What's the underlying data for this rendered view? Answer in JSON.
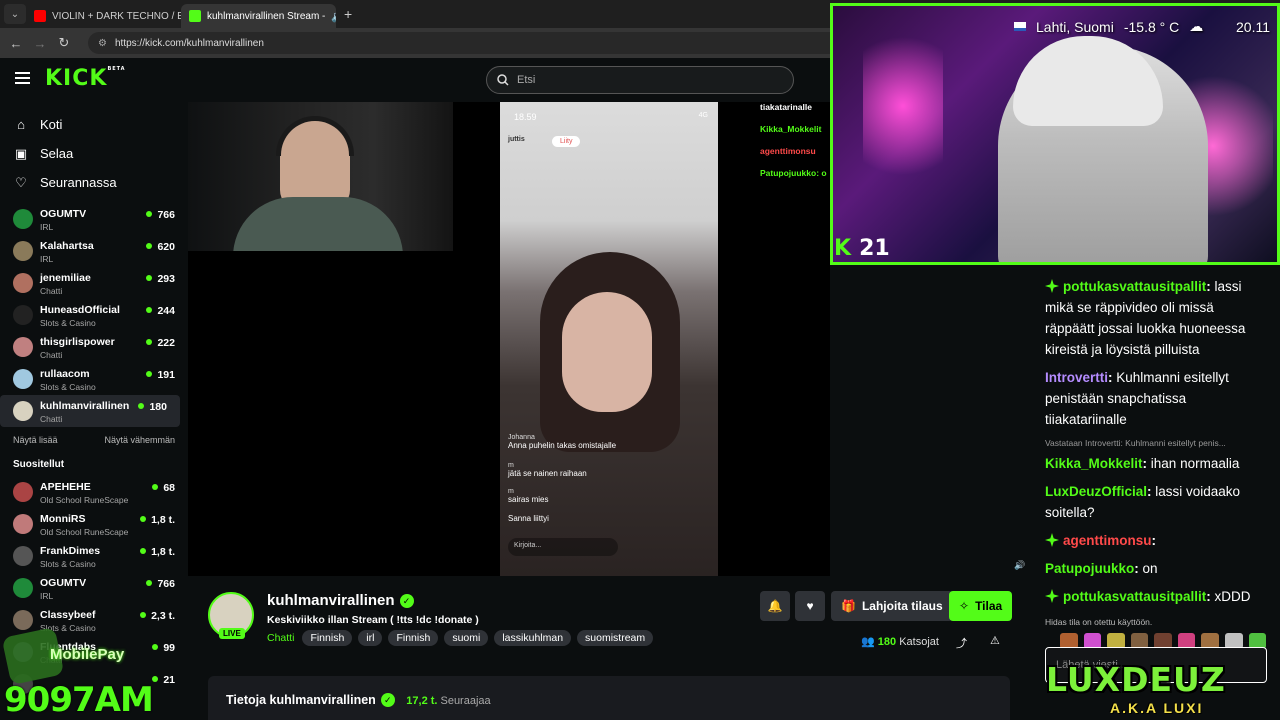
{
  "browser": {
    "tabs": [
      {
        "title": "VIOLIN + DARK TECHNO / EBM",
        "color": "#ff0000"
      },
      {
        "title": "kuhlmanvirallinen Stream -",
        "color": "#53fc18"
      }
    ],
    "url": "https://kick.com/kuhlmanvirallinen"
  },
  "header": {
    "logo": "KICK",
    "logo_sup": "BETA",
    "search_placeholder": "Etsi"
  },
  "sidebar": {
    "nav": [
      {
        "label": "Koti",
        "icon": "home-icon"
      },
      {
        "label": "Selaa",
        "icon": "browse-icon"
      },
      {
        "label": "Seurannassa",
        "icon": "heart-icon"
      }
    ],
    "following": [
      {
        "name": "OGUMTV",
        "category": "IRL",
        "viewers": "766",
        "color": "#1f8a3a"
      },
      {
        "name": "Kalahartsa",
        "category": "IRL",
        "viewers": "620",
        "color": "#8a7a5a"
      },
      {
        "name": "jenemiliae",
        "category": "Chatti",
        "viewers": "293",
        "color": "#b07060"
      },
      {
        "name": "HuneasdOfficial",
        "category": "Slots & Casino",
        "viewers": "244",
        "color": "#222"
      },
      {
        "name": "thisgirlispower",
        "category": "Chatti",
        "viewers": "222",
        "color": "#c08080"
      },
      {
        "name": "rullaacom",
        "category": "Slots & Casino",
        "viewers": "191",
        "color": "#a0c8e0"
      },
      {
        "name": "kuhlmanvirallinen",
        "category": "Chatti",
        "viewers": "180",
        "color": "#d8d2c0"
      }
    ],
    "show_more": "Näytä lisää",
    "show_less": "Näytä vähemmän",
    "recommended_title": "Suositellut",
    "recommended": [
      {
        "name": "APEHEHE",
        "category": "Old School RuneScape",
        "viewers": "68",
        "color": "#aa4444"
      },
      {
        "name": "MonniRS",
        "category": "Old School RuneScape",
        "viewers": "1,8 t.",
        "color": "#c07a7a"
      },
      {
        "name": "FrankDimes",
        "category": "Slots & Casino",
        "viewers": "1,8 t.",
        "color": "#555"
      },
      {
        "name": "OGUMTV",
        "category": "IRL",
        "viewers": "766",
        "color": "#1f8a3a"
      },
      {
        "name": "Classybeef",
        "category": "Slots & Casino",
        "viewers": "2,3 t.",
        "color": "#7a6a5a"
      },
      {
        "name": "Fluentdabs",
        "category": "Chatti",
        "viewers": "99",
        "color": "#6a6a8a"
      },
      {
        "name": "",
        "category": "",
        "viewers": "21",
        "color": "#444"
      }
    ]
  },
  "video": {
    "phone_time": "18.59",
    "phone_net": "4G",
    "phone_user": "juttis",
    "phone_join": "Liity",
    "phone_comments": [
      {
        "user": "Johanna",
        "text": "Anna puhelin takas omistajalle"
      },
      {
        "user": "m",
        "text": "jätä se nainen raihaan"
      },
      {
        "user": "m",
        "text": "sairas mies"
      },
      {
        "user": "Sanna",
        "text": "liittyi"
      }
    ],
    "phone_ask": "Kirjoita...",
    "overlay_chat": [
      "tiakatarinalle",
      "Kikka_Mokkelit",
      "agenttimonsu",
      "Patupojuukko: o"
    ]
  },
  "facecam": {
    "location": "Lahti, Suomi",
    "temp": "-15.8 ° C",
    "time": "20.11",
    "count": "21",
    "count_logo": "K"
  },
  "stream": {
    "channel": "kuhlmanvirallinen",
    "live": "LIVE",
    "title": "Keskiviikko illan Stream ( !tts !dc !donate )",
    "category": "Chatti",
    "tags": [
      "Finnish",
      "irl",
      "Finnish",
      "suomi",
      "lassikuhlman",
      "suomistream"
    ],
    "gift_label": "Lahjoita tilaus",
    "subscribe_label": "Tilaa",
    "viewers": "180",
    "viewers_label": "Katsojat",
    "about_title": "Tietoja kuhlmanvirallinen",
    "followers": "17,2 t.",
    "followers_label": "Seuraajaa"
  },
  "chat": {
    "messages": [
      {
        "user": "pottukasvattausitpallit",
        "color": "#53fc18",
        "badge": "#53fc18",
        "text": "lassi mikä se räppivideo oli missä räppäätt jossai luokka huoneessa kireistä ja löysistä pilluista"
      },
      {
        "user": "Introvertti",
        "color": "#b58cff",
        "badge": "",
        "text": "Kuhlmanni esitellyt penistään snapchatissa tiiakatariinalle"
      },
      {
        "user": "Kikka_Mokkelit",
        "color": "#53fc18",
        "badge": "",
        "text": "ihan normaalia",
        "reply": "Vastataan Introvertti: Kuhlmanni esitellyt penis..."
      },
      {
        "user": "LuxDeuzOfficial",
        "color": "#53fc18",
        "badge": "",
        "text": "lassi voidaako soitella?"
      },
      {
        "user": "agenttimonsu",
        "color": "#ff4a4a",
        "badge": "#53fc18",
        "text": ""
      },
      {
        "user": "Patupojuukko",
        "color": "#53fc18",
        "badge": "",
        "text": "on"
      },
      {
        "user": "pottukasvattausitpallit",
        "color": "#53fc18",
        "badge": "#53fc18",
        "text": "xDDD"
      }
    ],
    "slow_mode": "Hidas tila on otettu käyttöön.",
    "input_placeholder": "Lähetä viesti..."
  },
  "overlays": {
    "mobilepay": "MobilePay",
    "mobilepay_number": "9097AM",
    "brand": "LUXDEUZ",
    "brand_sub": "A.K.A LUXI"
  }
}
